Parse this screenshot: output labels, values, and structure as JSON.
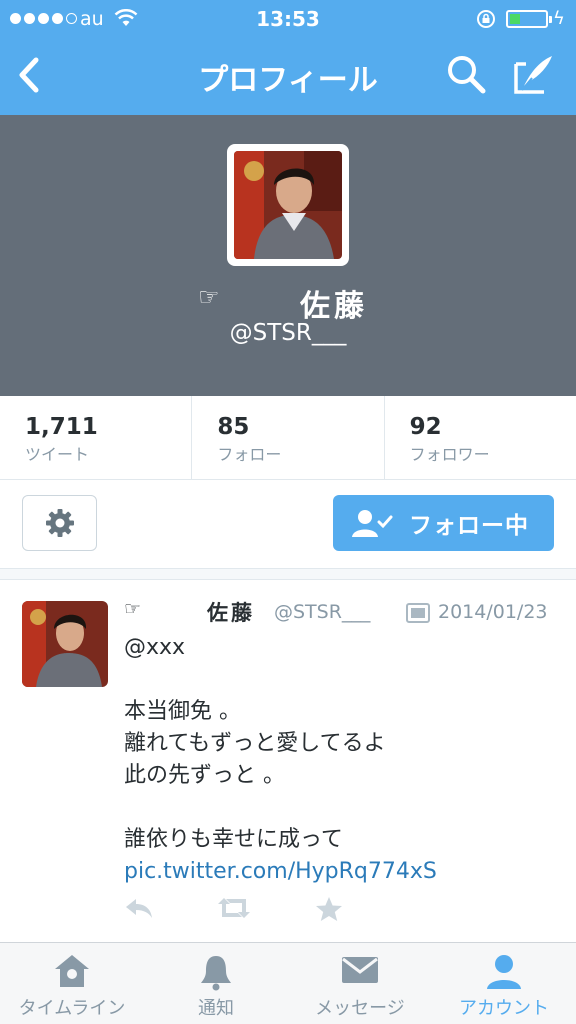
{
  "status_bar": {
    "carrier": "au",
    "time": "13:53",
    "battery_level": 0.3
  },
  "nav": {
    "title": "プロフィール"
  },
  "profile": {
    "hand_glyph": "☞",
    "name": "佐藤",
    "handle": "@STSR___"
  },
  "stats": [
    {
      "value": "1,711",
      "label": "ツイート"
    },
    {
      "value": "85",
      "label": "フォロー"
    },
    {
      "value": "92",
      "label": "フォロワー"
    }
  ],
  "actions": {
    "follow_label": "フォロー中"
  },
  "tweet": {
    "hand_glyph": "☞",
    "name": "佐藤",
    "handle": "@STSR___",
    "date": "2014/01/23",
    "lines": [
      "@xxx",
      "",
      "本当御免 。",
      "離れてもずっと愛してるよ",
      "此の先ずっと 。",
      "",
      "誰依りも幸せに成って"
    ],
    "link": "pic.twitter.com/HypRq774xS"
  },
  "tabbar": [
    {
      "label": "タイムライン",
      "icon": "home-icon",
      "active": false
    },
    {
      "label": "通知",
      "icon": "bell-icon",
      "active": false
    },
    {
      "label": "メッセージ",
      "icon": "envelope-icon",
      "active": false
    },
    {
      "label": "アカウント",
      "icon": "person-icon",
      "active": true
    }
  ],
  "colors": {
    "brand": "#55acee",
    "header_bg": "#646e79",
    "text": "#292f33",
    "muted": "#8899a6",
    "link": "#2b7bb9"
  }
}
